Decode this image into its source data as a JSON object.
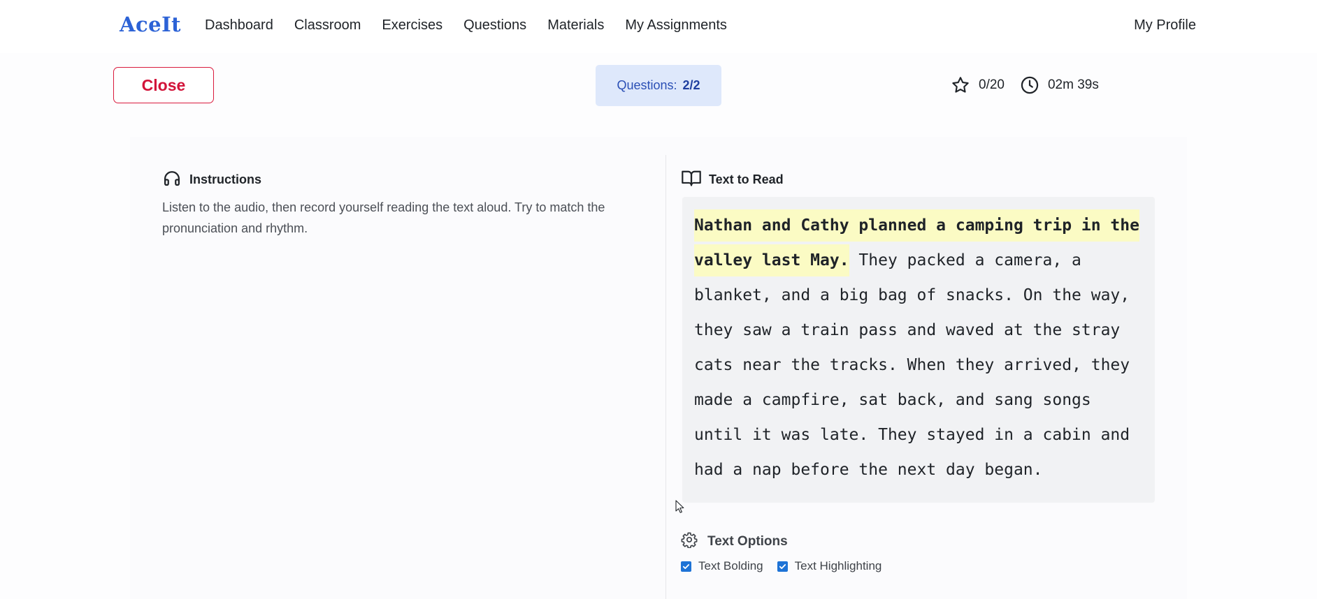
{
  "nav": {
    "logo": "AceIt",
    "links": [
      "Dashboard",
      "Classroom",
      "Exercises",
      "Questions",
      "Materials",
      "My Assignments"
    ],
    "profile": "My Profile"
  },
  "toolbar": {
    "close_label": "Close",
    "questions_label": "Questions:",
    "questions_count": "2/2",
    "score": "0/20",
    "timer": "02m 39s"
  },
  "instructions": {
    "title": "Instructions",
    "text": "Listen to the audio, then record yourself reading the text aloud. Try to match the pronunciation and rhythm."
  },
  "reading": {
    "title": "Text to Read",
    "highlighted": "Nathan and Cathy planned a camping trip in the valley last May.",
    "rest": " They packed a camera, a blanket, and a big bag of snacks. On the way, they saw a train pass and waved at the stray cats near the tracks. When they arrived, they made a campfire, sat back, and sang songs until it was late. They stayed in a cabin and had a nap before the next day began."
  },
  "options": {
    "title": "Text Options",
    "bolding_label": "Text Bolding",
    "bolding_checked": true,
    "highlighting_label": "Text Highlighting",
    "highlighting_checked": true
  },
  "colors": {
    "brand": "#2c62d6",
    "close": "#d2143a",
    "highlight": "#fbfbc4",
    "checkbox": "#1e73d6"
  }
}
